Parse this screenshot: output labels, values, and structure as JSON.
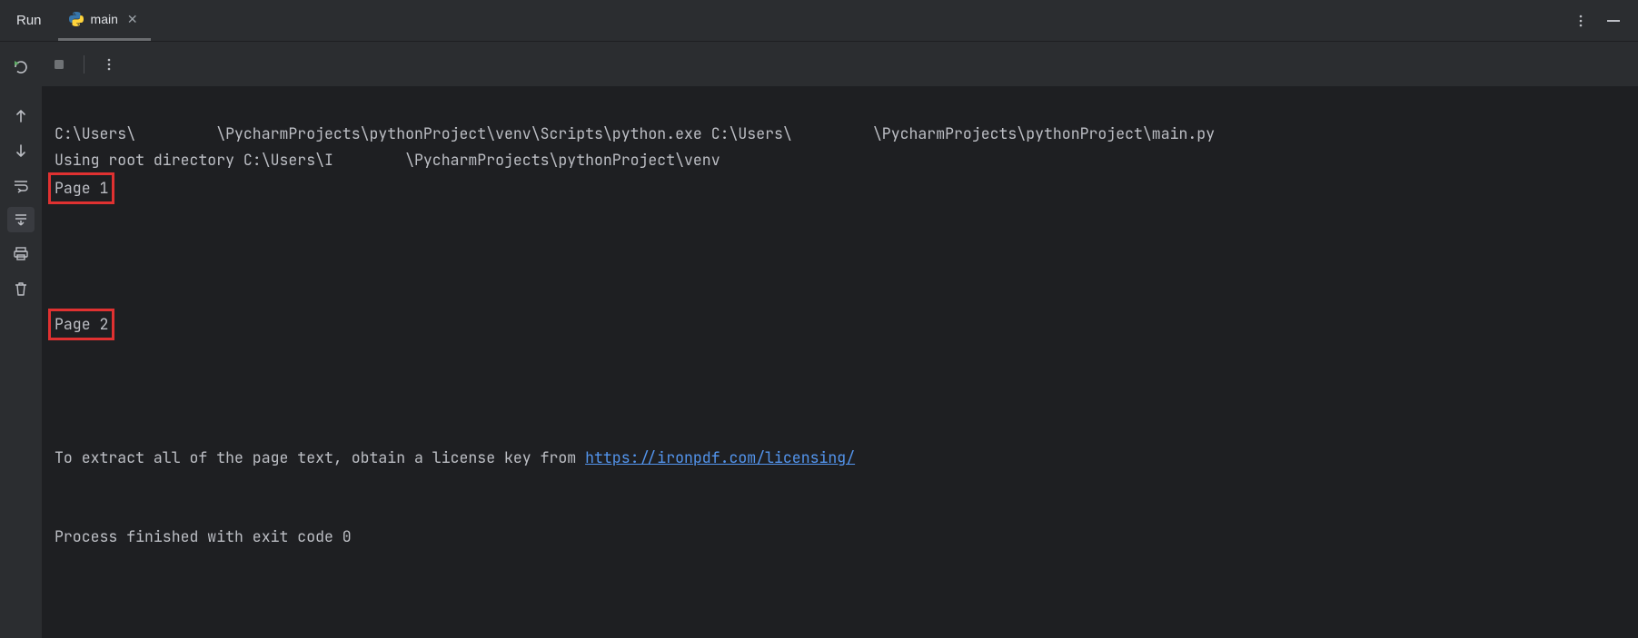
{
  "header": {
    "run_label": "Run",
    "tab": {
      "filename": "main"
    }
  },
  "console": {
    "line_exec": "C:\\Users\\         \\PycharmProjects\\pythonProject\\venv\\Scripts\\python.exe C:\\Users\\         \\PycharmProjects\\pythonProject\\main.py ",
    "line_root": "Using root directory C:\\Users\\I        \\PycharmProjects\\pythonProject\\venv",
    "page1": "Page 1",
    "page2": "Page 2",
    "license_pre": "To extract all of the page text, obtain a license key from ",
    "license_url": "https://ironpdf.com/licensing/",
    "exit_line": "Process finished with exit code 0"
  }
}
